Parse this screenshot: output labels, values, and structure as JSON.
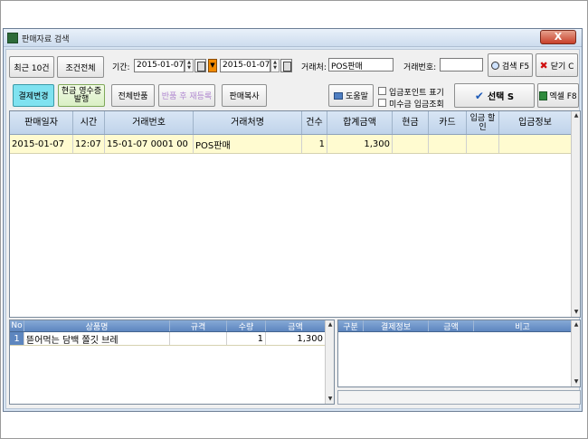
{
  "window": {
    "title": "판매자료 검색",
    "close_label": "X"
  },
  "toolbar1": {
    "recent_label": "최근 10건",
    "all_label": "조건전체",
    "period_label": "기간:",
    "date_from": "2015-01-07",
    "date_to": "2015-01-07",
    "client_label": "거래처:",
    "client_value": "POS판매",
    "txn_label": "거래번호:",
    "txn_value": "",
    "search_label": "검색 F5",
    "close_label": "닫기 C"
  },
  "toolbar2": {
    "change_payment": "결제변경",
    "cash_receipt_line1": "현금 영수증",
    "cash_receipt_line2": "발행",
    "return_all": "전체반품",
    "return_reregister": "반품 후 재등록",
    "copy_sale": "판매복사",
    "help": "도움말",
    "show_deposit_point": "입금포인트 표기",
    "unpaid_deposit": "미수금 입금조회",
    "select": "선택 S",
    "excel": "엑셀 F8"
  },
  "main_table": {
    "columns": [
      "판매일자",
      "시간",
      "거래번호",
      "거래처명",
      "건수",
      "합계금액",
      "현금",
      "카드",
      "입금 할인",
      "입금정보"
    ],
    "rows": [
      [
        "2015-01-07",
        "12:07",
        "15-01-07 0001 00",
        "POS판매",
        "1",
        "1,300",
        "",
        "",
        "",
        ""
      ]
    ]
  },
  "items_table": {
    "columns": [
      "No",
      "상품명",
      "규격",
      "수량",
      "금액"
    ],
    "rows": [
      [
        "1",
        "뜯어먹는 담백 쫄깃 브레",
        "",
        "1",
        "1,300"
      ]
    ]
  },
  "payment_table": {
    "columns": [
      "구분",
      "결제정보",
      "금액",
      "비고"
    ],
    "rows": []
  },
  "colors": {
    "selected_row": "#fffbd0",
    "header_blue": "#5d86bf",
    "change_payment_bg": "#7fe2f0"
  }
}
